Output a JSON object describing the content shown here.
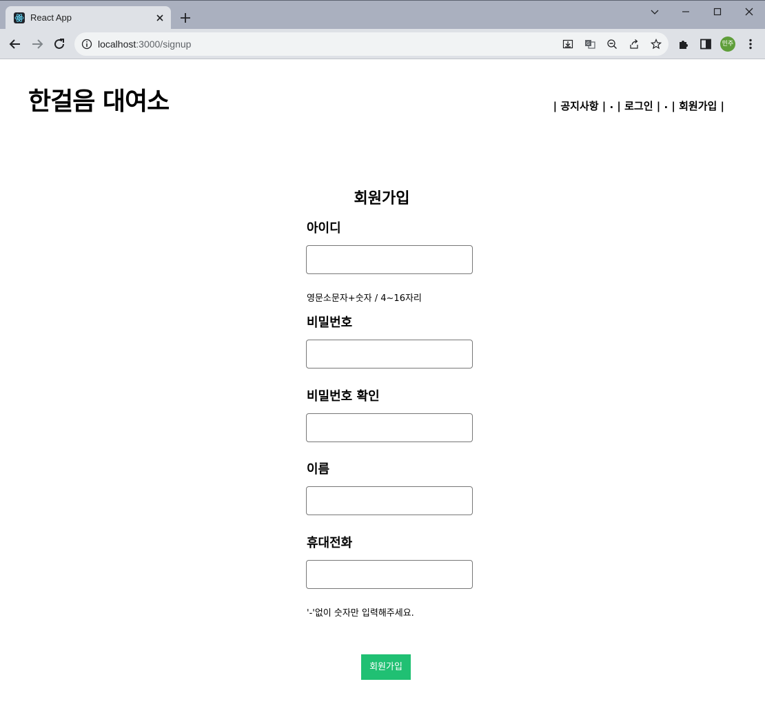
{
  "browser": {
    "tab_title": "React App",
    "url_host": "localhost",
    "url_path": ":3000/signup",
    "profile_label": "민주"
  },
  "header": {
    "brand": "한걸음 대여소",
    "nav": [
      "| 공지사항 |",
      " . ",
      "| 로그인 |",
      " . ",
      "| 회원가입 |"
    ]
  },
  "form": {
    "title": "회원가입",
    "fields": [
      {
        "label": "아이디",
        "value": "",
        "hint": "영문소문자+숫자 / 4~16자리"
      },
      {
        "label": "비밀번호",
        "value": ""
      },
      {
        "label": "비밀번호 확인",
        "value": ""
      },
      {
        "label": "이름",
        "value": ""
      },
      {
        "label": "휴대전화",
        "value": "",
        "hint": "'-'없이 숫자만 입력해주세요."
      }
    ],
    "submit_label": "회원가입"
  }
}
